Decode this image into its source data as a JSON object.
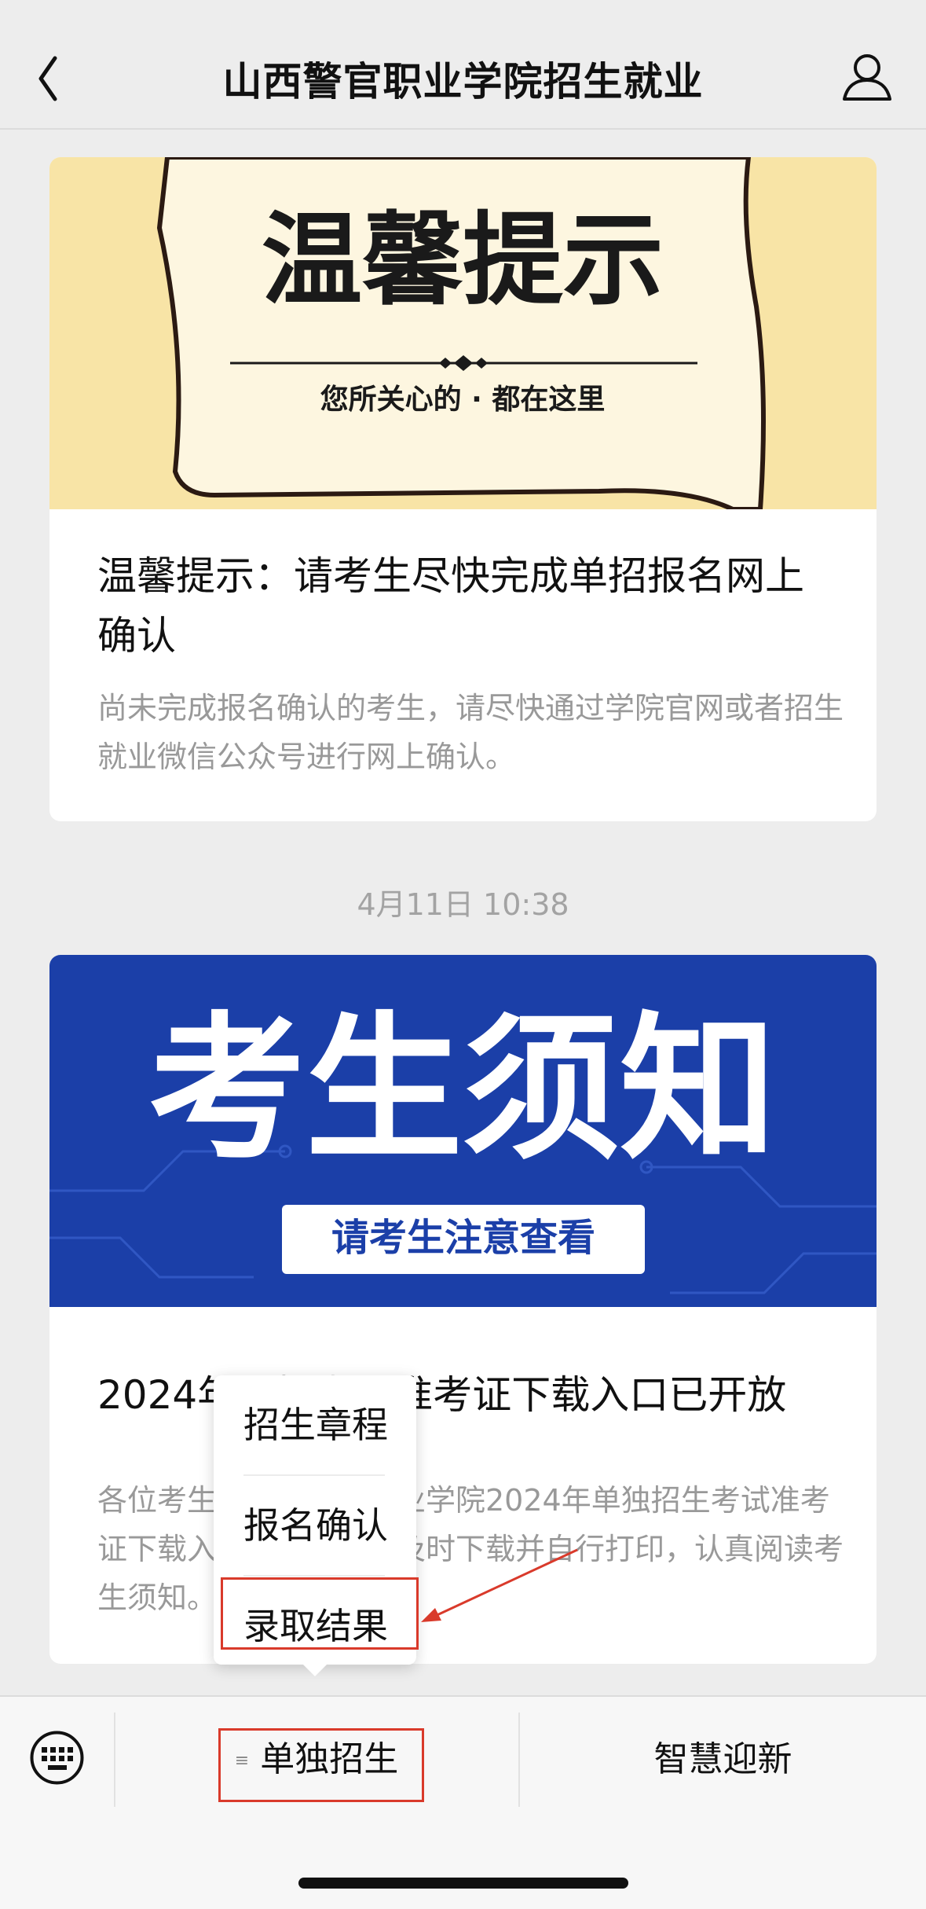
{
  "header": {
    "title": "山西警官职业学院招生就业"
  },
  "articles": [
    {
      "cover": {
        "headline": "温馨提示",
        "subline": "您所关心的 · 都在这里",
        "bg_color": "#f8e4a6"
      },
      "title": "温馨提示：请考生尽快完成单招报名网上确认",
      "description": "尚未完成报名确认的考生，请尽快通过学院官网或者招生就业微信公众号进行网上确认。"
    },
    {
      "timestamp": "4月11日 10:38",
      "cover": {
        "headline": "考生须知",
        "subline": "请考生注意查看",
        "bg_color": "#1b3fa8"
      },
      "title": "2024年单招考试准考证下载入口已开放",
      "description": "各位考生：山西警官职业学院2024年单独招生考试准考证下载入口已开放，请及时下载并自行打印，认真阅读考生须知。"
    }
  ],
  "popup_menu": {
    "items": [
      "招生章程",
      "报名确认",
      "录取结果"
    ],
    "highlighted": "录取结果"
  },
  "bottom_menu": {
    "tabs": [
      "单独招生",
      "智慧迎新"
    ],
    "highlighted": "单独招生"
  },
  "colors": {
    "annotation_red": "#d93a2b",
    "background": "#ededed"
  }
}
